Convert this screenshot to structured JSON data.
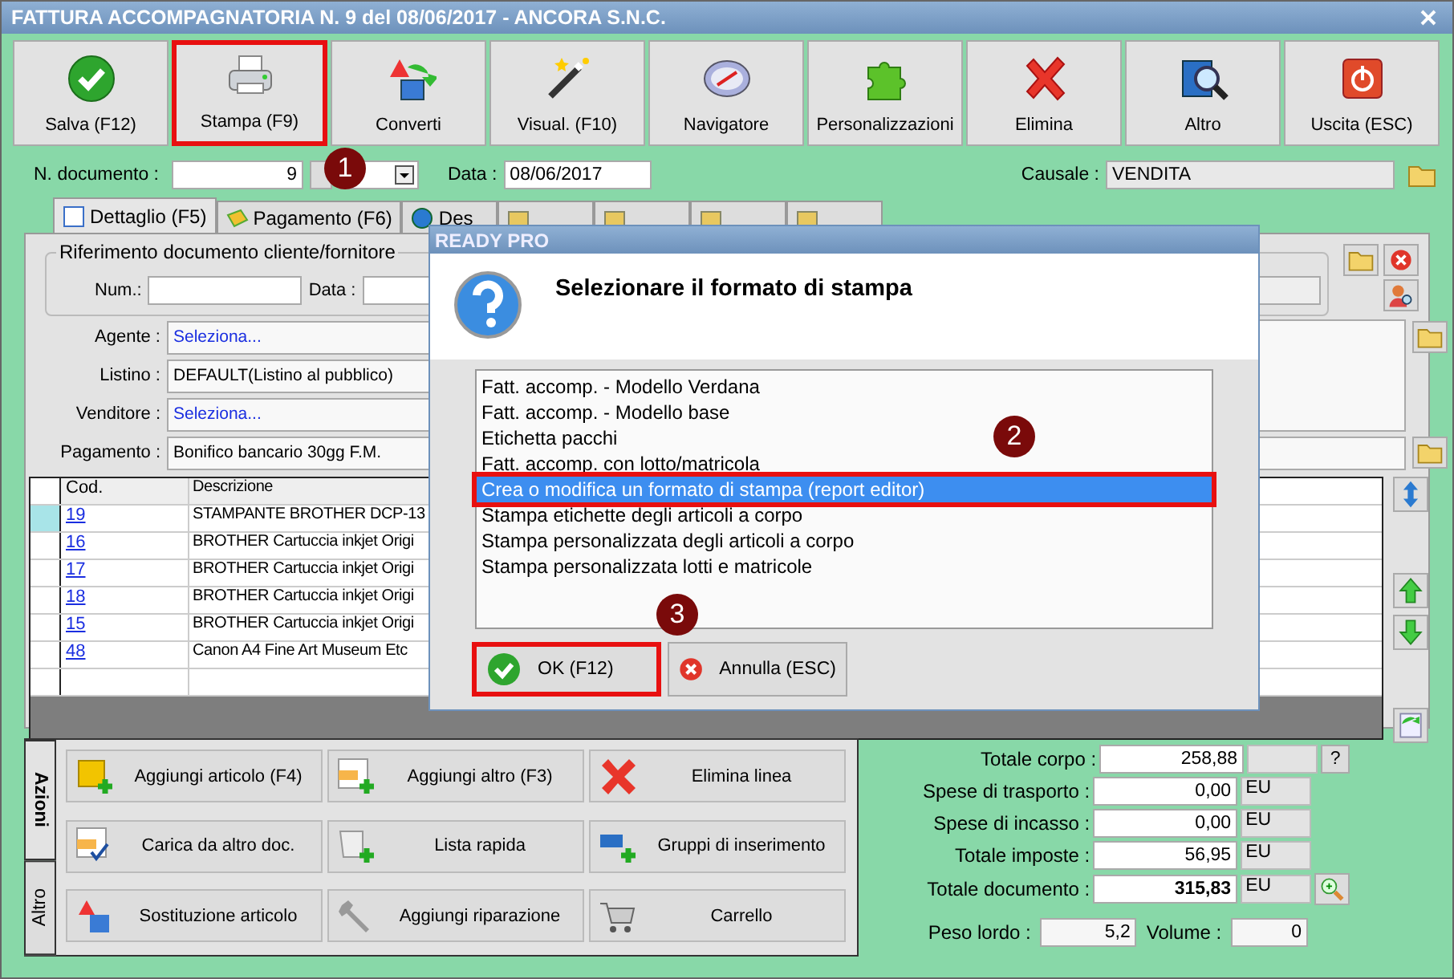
{
  "window": {
    "title": "FATTURA ACCOMPAGNATORIA N. 9 del 08/06/2017 - ANCORA S.N.C."
  },
  "toolbar": [
    {
      "label": "Salva (F12)",
      "highlighted": false
    },
    {
      "label": "Stampa (F9)",
      "highlighted": true
    },
    {
      "label": "Converti",
      "highlighted": false
    },
    {
      "label": "Visual. (F10)",
      "highlighted": false
    },
    {
      "label": "Navigatore",
      "highlighted": false
    },
    {
      "label": "Personalizzazioni",
      "highlighted": false
    },
    {
      "label": "Elimina",
      "highlighted": false
    },
    {
      "label": "Altro",
      "highlighted": false
    },
    {
      "label": "Uscita (ESC)",
      "highlighted": false
    }
  ],
  "document": {
    "number_label": "N. documento :",
    "number": "9",
    "marker": "1",
    "date_label": "Data :",
    "date": "08/06/2017",
    "reason_label": "Causale :",
    "reason": "VENDITA"
  },
  "tabs": [
    {
      "label": "Dettaglio (F5)",
      "selected": true
    },
    {
      "label": "Pagamento (F6)",
      "selected": false
    },
    {
      "label": "Des",
      "selected": false
    },
    {
      "selected": false
    },
    {
      "selected": false
    },
    {
      "selected": false
    },
    {
      "selected": false
    }
  ],
  "reference": {
    "title": "Riferimento documento cliente/fornitore",
    "num_label": "Num.:",
    "date_label": "Data :"
  },
  "fields": [
    {
      "label": "Agente :",
      "value": "Seleziona...",
      "kind": "link"
    },
    {
      "label": "Listino :",
      "value": "DEFAULT(Listino al pubblico)",
      "kind": "plain"
    },
    {
      "label": "Venditore :",
      "value": "Seleziona...",
      "kind": "link"
    },
    {
      "label": "Pagamento :",
      "value": "Bonifico bancario 30gg F.M.",
      "kind": "plain"
    }
  ],
  "table": {
    "columns": [
      "Cod.",
      "Descrizione"
    ],
    "rows": [
      {
        "code": "19",
        "description": "STAMPANTE BROTHER DCP-13",
        "selected": true
      },
      {
        "code": "16",
        "description": "BROTHER Cartuccia inkjet Origi",
        "selected": false
      },
      {
        "code": "17",
        "description": "BROTHER Cartuccia inkjet Origi",
        "selected": false
      },
      {
        "code": "18",
        "description": "BROTHER Cartuccia inkjet Origi",
        "selected": false
      },
      {
        "code": "15",
        "description": "BROTHER Cartuccia inkjet Origi",
        "selected": false
      },
      {
        "code": "48",
        "description": "Canon A4 Fine Art Museum Etc",
        "selected": false
      }
    ]
  },
  "actions": {
    "tabs": [
      {
        "label": "Azioni",
        "selected": true
      },
      {
        "label": "Altro",
        "selected": false
      }
    ],
    "buttons": [
      "Aggiungi articolo (F4)",
      "Aggiungi altro (F3)",
      "Elimina linea",
      "Carica da altro doc.",
      "Lista rapida",
      "Gruppi di inserimento",
      "Sostituzione articolo",
      "Aggiungi riparazione",
      "Carrello"
    ]
  },
  "totals": [
    {
      "label": "Totale corpo :",
      "value": "258,88",
      "kind": "plain"
    },
    {
      "label": "Spese di trasporto :",
      "value": "0,00",
      "unit": "EU",
      "kind": "plain"
    },
    {
      "label": "Spese di incasso :",
      "value": "0,00",
      "unit": "EU",
      "kind": "plain"
    },
    {
      "label": "Totale imposte :",
      "value": "56,95",
      "unit": "EU",
      "kind": "plain"
    },
    {
      "label": "Totale documento :",
      "value": "315,83",
      "unit": "EU",
      "kind": "total"
    }
  ],
  "help_button": "?",
  "weight": {
    "label": "Peso lordo :",
    "value": "5,2"
  },
  "volume": {
    "label": "Volume :",
    "value": "0"
  },
  "dialog": {
    "title": "READY PRO",
    "heading": "Selezionare il formato di stampa",
    "options": [
      {
        "label": "Fatt. accomp. - Modello Verdana",
        "selected": false,
        "highlighted": false
      },
      {
        "label": "Fatt. accomp. - Modello base",
        "selected": false,
        "highlighted": false
      },
      {
        "label": "Etichetta pacchi",
        "selected": false,
        "highlighted": false
      },
      {
        "label": "Fatt. accomp. con lotto/matricola",
        "selected": false,
        "highlighted": false
      },
      {
        "label": "Crea o modifica un formato di stampa (report editor)",
        "selected": true,
        "highlighted": true
      },
      {
        "label": "Stampa etichette degli articoli a corpo",
        "selected": false,
        "highlighted": false
      },
      {
        "label": "Stampa personalizzata degli articoli a corpo",
        "selected": false,
        "highlighted": false
      },
      {
        "label": "Stampa personalizzata lotti e matricole",
        "selected": false,
        "highlighted": false
      }
    ],
    "option_marker": "2",
    "ok": {
      "label": "OK (F12)",
      "highlighted": true,
      "marker": "3"
    },
    "cancel": {
      "label": "Annulla (ESC)"
    }
  }
}
